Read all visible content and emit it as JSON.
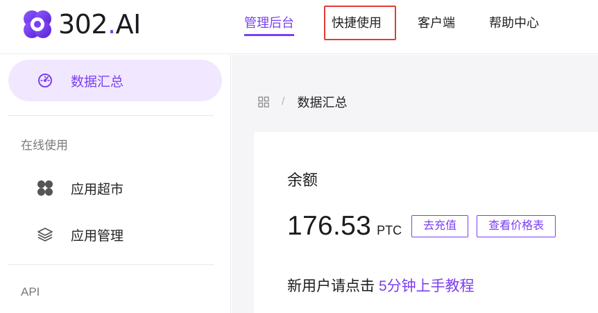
{
  "brand": {
    "name_prefix": "302",
    "name_dot": ".",
    "name_suffix": "AI",
    "accent": "#7b3ff2"
  },
  "nav": {
    "items": [
      {
        "label": "管理后台",
        "active": true
      },
      {
        "label": "快捷使用",
        "highlighted": true
      },
      {
        "label": "客户端"
      },
      {
        "label": "帮助中心"
      }
    ]
  },
  "sidebar": {
    "dashboard": {
      "label": "数据汇总",
      "icon": "dashboard-icon"
    },
    "groups": [
      {
        "title": "在线使用",
        "items": [
          {
            "label": "应用超市",
            "icon": "grid-icon"
          },
          {
            "label": "应用管理",
            "icon": "layers-icon"
          }
        ]
      },
      {
        "title": "API"
      }
    ]
  },
  "breadcrumb": {
    "icon": "grid-small-icon",
    "separator": "/",
    "current": "数据汇总"
  },
  "balance_card": {
    "title": "余额",
    "value": "176.53",
    "unit": "PTC",
    "recharge_label": "去充值",
    "pricing_label": "查看价格表",
    "tip_text": "新用户请点击",
    "tip_link": "5分钟上手教程"
  }
}
